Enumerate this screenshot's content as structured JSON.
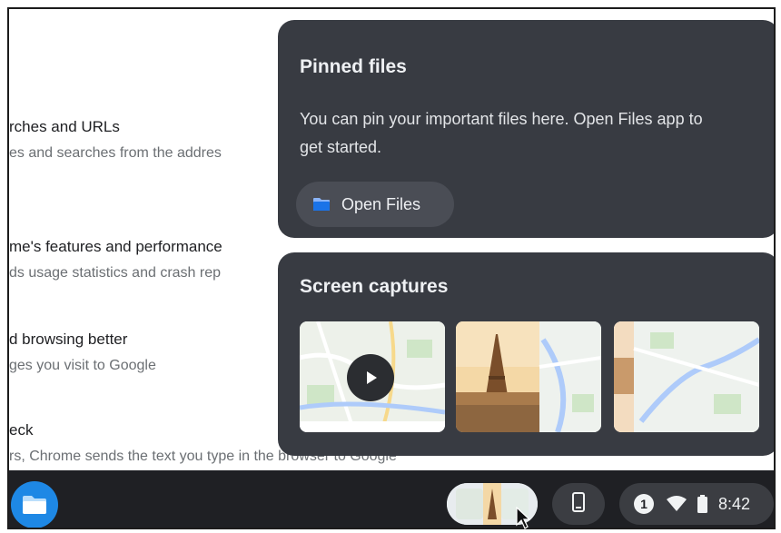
{
  "settings": {
    "items": [
      {
        "title": "rches and URLs",
        "desc": "es and searches from the addres"
      },
      {
        "title": "me's features and performance",
        "desc": "ds usage statistics and crash rep"
      },
      {
        "title": "d browsing better",
        "desc": "ges you visit to Google"
      },
      {
        "title": "eck",
        "desc": "rs, Chrome sends the text you type in the browser to Google"
      }
    ]
  },
  "pinned": {
    "title": "Pinned files",
    "text": "You can pin your important files here. Open Files app to get started.",
    "button_label": "Open Files",
    "button_icon": "folder-icon"
  },
  "captures": {
    "title": "Screen captures",
    "thumbnails": [
      {
        "kind": "video",
        "icon": "play-icon",
        "subject": "map"
      },
      {
        "kind": "image",
        "subject": "eiffel-tower-and-map"
      },
      {
        "kind": "image",
        "subject": "map"
      }
    ]
  },
  "shelf": {
    "launcher_icon": "files-app-icon",
    "phone_icon": "phone-hub-icon",
    "notification_count": "1",
    "wifi_icon": "wifi-icon",
    "battery_icon": "battery-icon",
    "time": "8:42"
  },
  "colors": {
    "panel_bg": "#383b42",
    "shelf_bg": "#1f2024",
    "accent_blue": "#1e88e5"
  }
}
